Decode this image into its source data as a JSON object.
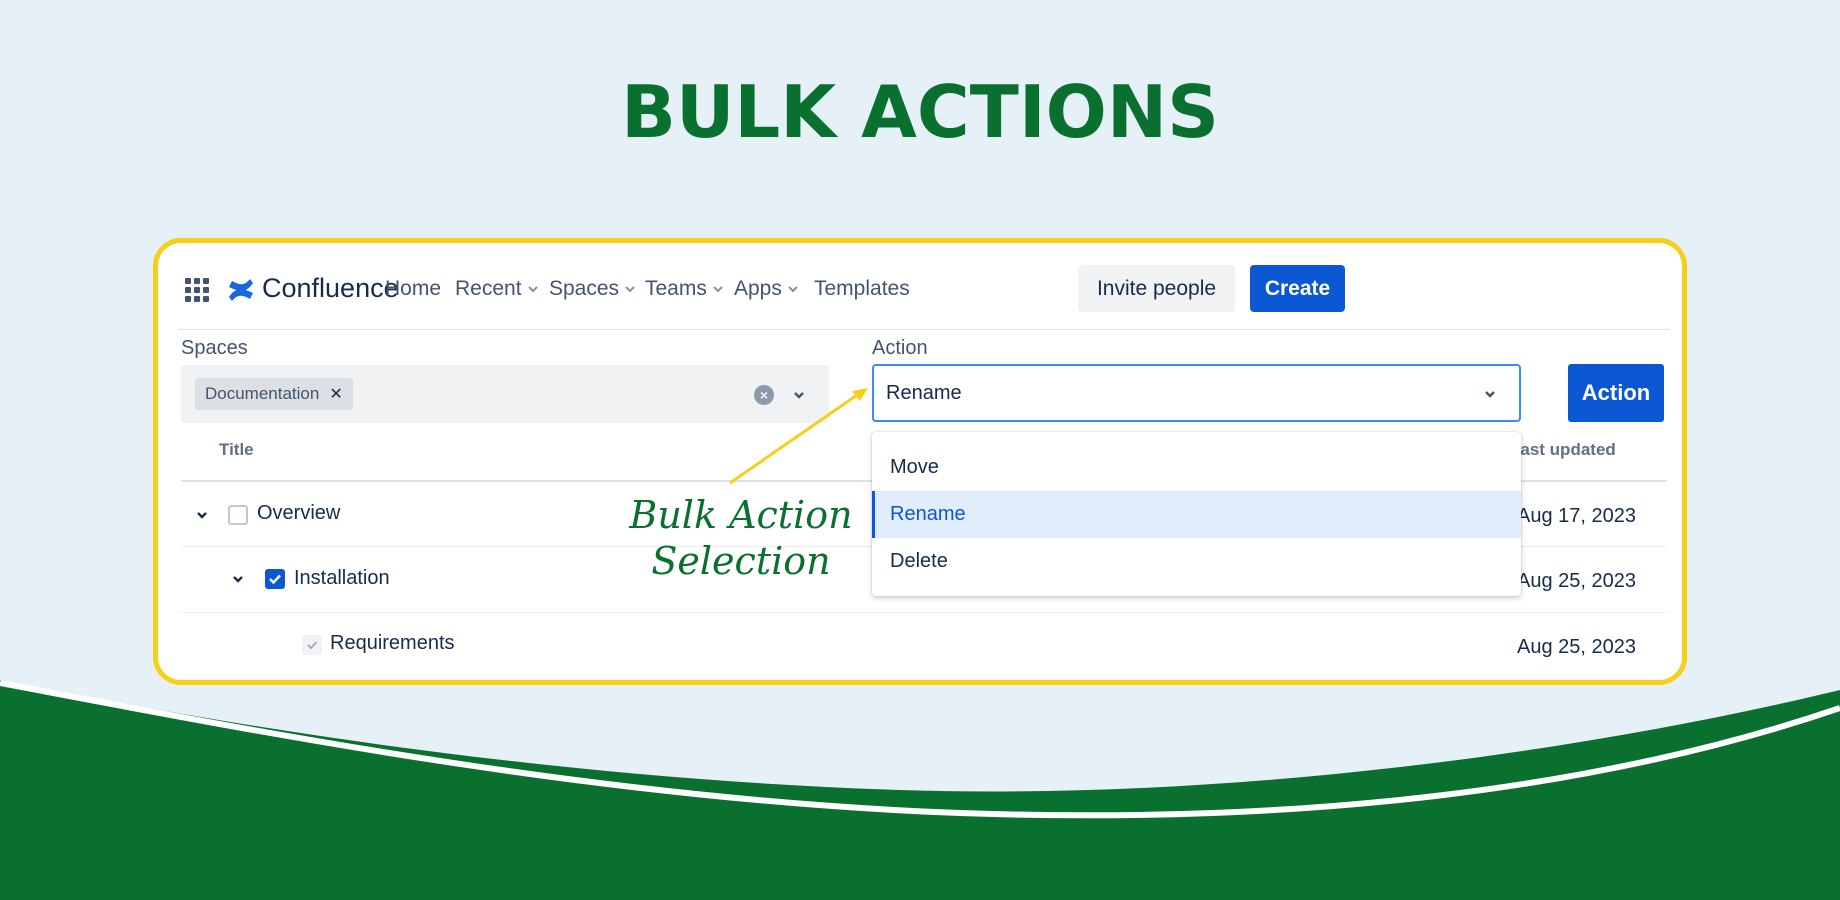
{
  "slide": {
    "title": "BULK ACTIONS"
  },
  "nav": {
    "logo_text": "Confluence",
    "items": [
      {
        "label": "Home",
        "has_chevron": false
      },
      {
        "label": "Recent",
        "has_chevron": true
      },
      {
        "label": "Spaces",
        "has_chevron": true
      },
      {
        "label": "Teams",
        "has_chevron": true
      },
      {
        "label": "Apps",
        "has_chevron": true
      },
      {
        "label": "Templates",
        "has_chevron": false
      }
    ],
    "invite_label": "Invite people",
    "create_label": "Create"
  },
  "filters": {
    "spaces_label": "Spaces",
    "spaces_tag": "Documentation",
    "action_label": "Action",
    "action_value": "Rename",
    "action_button": "Action"
  },
  "table": {
    "columns": {
      "title": "Title",
      "last_updated": "Last updated"
    },
    "rows": [
      {
        "title": "Overview",
        "date": "Aug 17, 2023",
        "checked": false
      },
      {
        "title": "Installation",
        "date": "Aug 25, 2023",
        "checked": true
      },
      {
        "title": "Requirements",
        "date": "Aug 25, 2023",
        "checked": "disabled"
      }
    ]
  },
  "dropdown": {
    "options": [
      "Move",
      "Rename",
      "Delete"
    ],
    "selected": "Rename"
  },
  "annotation": {
    "line1": "Bulk Action",
    "line2": "Selection"
  },
  "colors": {
    "brand_green": "#0a7030",
    "frame_yellow": "#f5cf19",
    "primary_blue": "#0c57d3",
    "background": "#e6f0f7"
  }
}
